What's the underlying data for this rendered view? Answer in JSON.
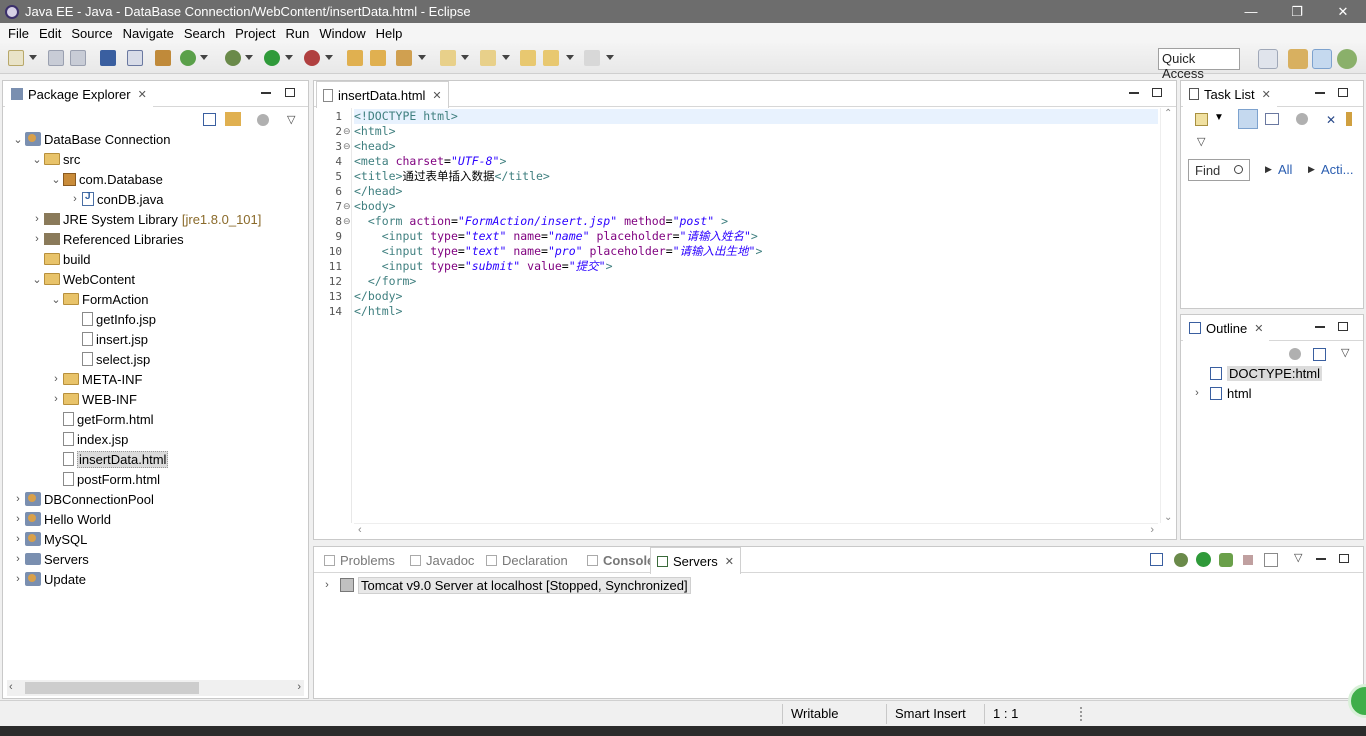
{
  "window": {
    "title": "Java EE - Java - DataBase Connection/WebContent/insertData.html - Eclipse",
    "minimize": "—",
    "restore": "❐",
    "close": "✕"
  },
  "menu": [
    "File",
    "Edit",
    "Source",
    "Navigate",
    "Search",
    "Project",
    "Run",
    "Window",
    "Help"
  ],
  "toolbar": {
    "quick_access": "Quick Access"
  },
  "package_explorer": {
    "tab_label": "Package Explorer",
    "tree": [
      {
        "label": "DataBase Connection",
        "decoration": "",
        "indent": 0,
        "twisty": "open",
        "icon": "project-icon"
      },
      {
        "label": "src",
        "decoration": "",
        "indent": 1,
        "twisty": "open",
        "icon": "folder-icon"
      },
      {
        "label": "com.Database",
        "decoration": "",
        "indent": 2,
        "twisty": "open",
        "icon": "package-icon"
      },
      {
        "label": "conDB.java",
        "decoration": "",
        "indent": 3,
        "twisty": "closed",
        "icon": "java-file-icon"
      },
      {
        "label": "JRE System Library",
        "decoration": "[jre1.8.0_101]",
        "indent": 1,
        "twisty": "closed",
        "icon": "library-icon"
      },
      {
        "label": "Referenced Libraries",
        "decoration": "",
        "indent": 1,
        "twisty": "closed",
        "icon": "library-icon"
      },
      {
        "label": "build",
        "decoration": "",
        "indent": 1,
        "twisty": "none",
        "icon": "folder-icon"
      },
      {
        "label": "WebContent",
        "decoration": "",
        "indent": 1,
        "twisty": "open",
        "icon": "folder-icon"
      },
      {
        "label": "FormAction",
        "decoration": "",
        "indent": 2,
        "twisty": "open",
        "icon": "folder-icon"
      },
      {
        "label": "getInfo.jsp",
        "decoration": "",
        "indent": 3,
        "twisty": "none",
        "icon": "file-icon"
      },
      {
        "label": "insert.jsp",
        "decoration": "",
        "indent": 3,
        "twisty": "none",
        "icon": "file-icon"
      },
      {
        "label": "select.jsp",
        "decoration": "",
        "indent": 3,
        "twisty": "none",
        "icon": "file-icon"
      },
      {
        "label": "META-INF",
        "decoration": "",
        "indent": 2,
        "twisty": "closed",
        "icon": "folder-icon"
      },
      {
        "label": "WEB-INF",
        "decoration": "",
        "indent": 2,
        "twisty": "closed",
        "icon": "folder-icon"
      },
      {
        "label": "getForm.html",
        "decoration": "",
        "indent": 2,
        "twisty": "none",
        "icon": "file-icon"
      },
      {
        "label": "index.jsp",
        "decoration": "",
        "indent": 2,
        "twisty": "none",
        "icon": "file-icon"
      },
      {
        "label": "insertData.html",
        "decoration": "",
        "indent": 2,
        "twisty": "none",
        "icon": "file-icon",
        "selected": true
      },
      {
        "label": "postForm.html",
        "decoration": "",
        "indent": 2,
        "twisty": "none",
        "icon": "file-icon"
      },
      {
        "label": "DBConnectionPool",
        "decoration": "",
        "indent": 0,
        "twisty": "closed",
        "icon": "project-icon"
      },
      {
        "label": "Hello World",
        "decoration": "",
        "indent": 0,
        "twisty": "closed",
        "icon": "project-icon"
      },
      {
        "label": "MySQL",
        "decoration": "",
        "indent": 0,
        "twisty": "closed",
        "icon": "project-icon"
      },
      {
        "label": "Servers",
        "decoration": "",
        "indent": 0,
        "twisty": "closed",
        "icon": "servers-icon"
      },
      {
        "label": "Update",
        "decoration": "",
        "indent": 0,
        "twisty": "closed",
        "icon": "project-icon"
      }
    ]
  },
  "editor": {
    "tab_label": "insertData.html",
    "lines": [
      {
        "n": "1",
        "fold": "",
        "html": "<span class=\"t\">&lt;!DOCTYPE html&gt;</span>"
      },
      {
        "n": "2",
        "fold": "⊖",
        "html": "<span class=\"t\">&lt;html&gt;</span>"
      },
      {
        "n": "3",
        "fold": "⊖",
        "html": "<span class=\"t\">&lt;head&gt;</span>"
      },
      {
        "n": "4",
        "fold": "",
        "html": "<span class=\"t\">&lt;meta</span> <span class=\"a\">charset</span>=<span class=\"v\">\"UTF-8\"</span><span class=\"t\">&gt;</span>"
      },
      {
        "n": "5",
        "fold": "",
        "html": "<span class=\"t\">&lt;title&gt;</span><span class=\"x\">通过表单插入数据</span><span class=\"t\">&lt;/title&gt;</span>"
      },
      {
        "n": "6",
        "fold": "",
        "html": "<span class=\"t\">&lt;/head&gt;</span>"
      },
      {
        "n": "7",
        "fold": "⊖",
        "html": "<span class=\"t\">&lt;body&gt;</span>"
      },
      {
        "n": "8",
        "fold": "⊖",
        "html": "  <span class=\"t\">&lt;form</span> <span class=\"a\">action</span>=<span class=\"v\">\"FormAction/insert.jsp\"</span> <span class=\"a\">method</span>=<span class=\"v\">\"post\"</span> <span class=\"t\">&gt;</span>"
      },
      {
        "n": "9",
        "fold": "",
        "html": "    <span class=\"t\">&lt;input</span> <span class=\"a\">type</span>=<span class=\"v\">\"text\"</span> <span class=\"a\">name</span>=<span class=\"v\">\"name\"</span> <span class=\"a\">placeholder</span>=<span class=\"v\">\"请输入姓名\"</span><span class=\"t\">&gt;</span>"
      },
      {
        "n": "10",
        "fold": "",
        "html": "    <span class=\"t\">&lt;input</span> <span class=\"a\">type</span>=<span class=\"v\">\"text\"</span> <span class=\"a\">name</span>=<span class=\"v\">\"pro\"</span> <span class=\"a\">placeholder</span>=<span class=\"v\">\"请输入出生地\"</span><span class=\"t\">&gt;</span>"
      },
      {
        "n": "11",
        "fold": "",
        "html": "    <span class=\"t\">&lt;input</span> <span class=\"a\">type</span>=<span class=\"v\">\"submit\"</span> <span class=\"a\">value</span>=<span class=\"v\">\"提交\"</span><span class=\"t\">&gt;</span>"
      },
      {
        "n": "12",
        "fold": "",
        "html": "  <span class=\"t\">&lt;/form&gt;</span>"
      },
      {
        "n": "13",
        "fold": "",
        "html": "<span class=\"t\">&lt;/body&gt;</span>"
      },
      {
        "n": "14",
        "fold": "",
        "html": "<span class=\"t\">&lt;/html&gt;</span>"
      }
    ]
  },
  "task_list": {
    "tab_label": "Task List",
    "find_placeholder": "Find",
    "all_label": "All",
    "activate_label": "Acti..."
  },
  "outline": {
    "tab_label": "Outline",
    "items": [
      {
        "label": "DOCTYPE:html",
        "twisty": "none",
        "selected": true
      },
      {
        "label": "html",
        "twisty": "closed",
        "selected": false
      }
    ]
  },
  "bottom_panel": {
    "tabs": [
      {
        "label": "Problems",
        "icon": "problems-icon",
        "active": false
      },
      {
        "label": "Javadoc",
        "icon": "javadoc-icon",
        "active": false
      },
      {
        "label": "Declaration",
        "icon": "declaration-icon",
        "active": false
      },
      {
        "label": "Console",
        "icon": "console-icon",
        "active": false
      },
      {
        "label": "Servers",
        "icon": "servers-icon",
        "active": true
      }
    ],
    "server_row": "Tomcat v9.0 Server at localhost  [Stopped, Synchronized]"
  },
  "status_bar": {
    "writable": "Writable",
    "insert_mode": "Smart Insert",
    "position": "1 : 1"
  }
}
